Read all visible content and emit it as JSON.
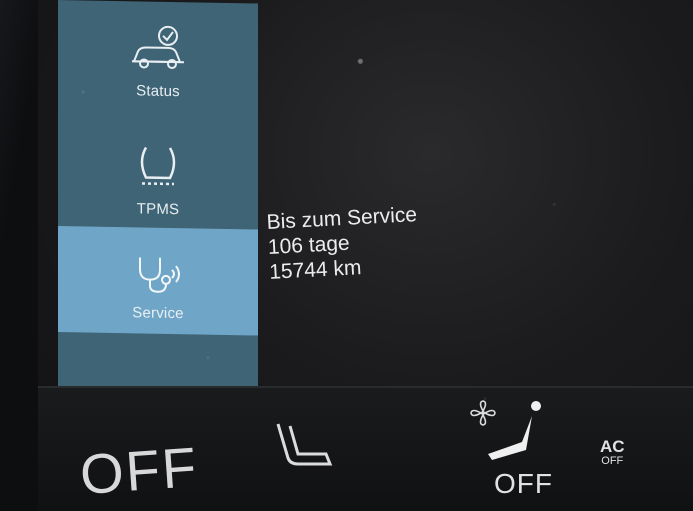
{
  "sidebar": {
    "items": [
      {
        "label": "Status",
        "icon": "car-check-icon",
        "selected": false
      },
      {
        "label": "TPMS",
        "icon": "tire-pressure-icon",
        "selected": false
      },
      {
        "label": "Service",
        "icon": "stethoscope-signal-icon",
        "selected": true
      }
    ]
  },
  "service_info": {
    "heading": "Bis zum Service",
    "days": "106 tage",
    "distance": "15744 km"
  },
  "climate_bar": {
    "left_temp_label": "OFF",
    "seat_heat_icon": "seat-heat-icon",
    "fan_icon": "fan-icon",
    "recline_icon": "seat-recline-icon",
    "right_label": "OFF",
    "ac_top": "AC",
    "ac_bottom": "OFF"
  },
  "colors": {
    "sidebar_bg": "#3f6475",
    "selected_bg": "#6fa6c8",
    "text": "#ececec"
  }
}
